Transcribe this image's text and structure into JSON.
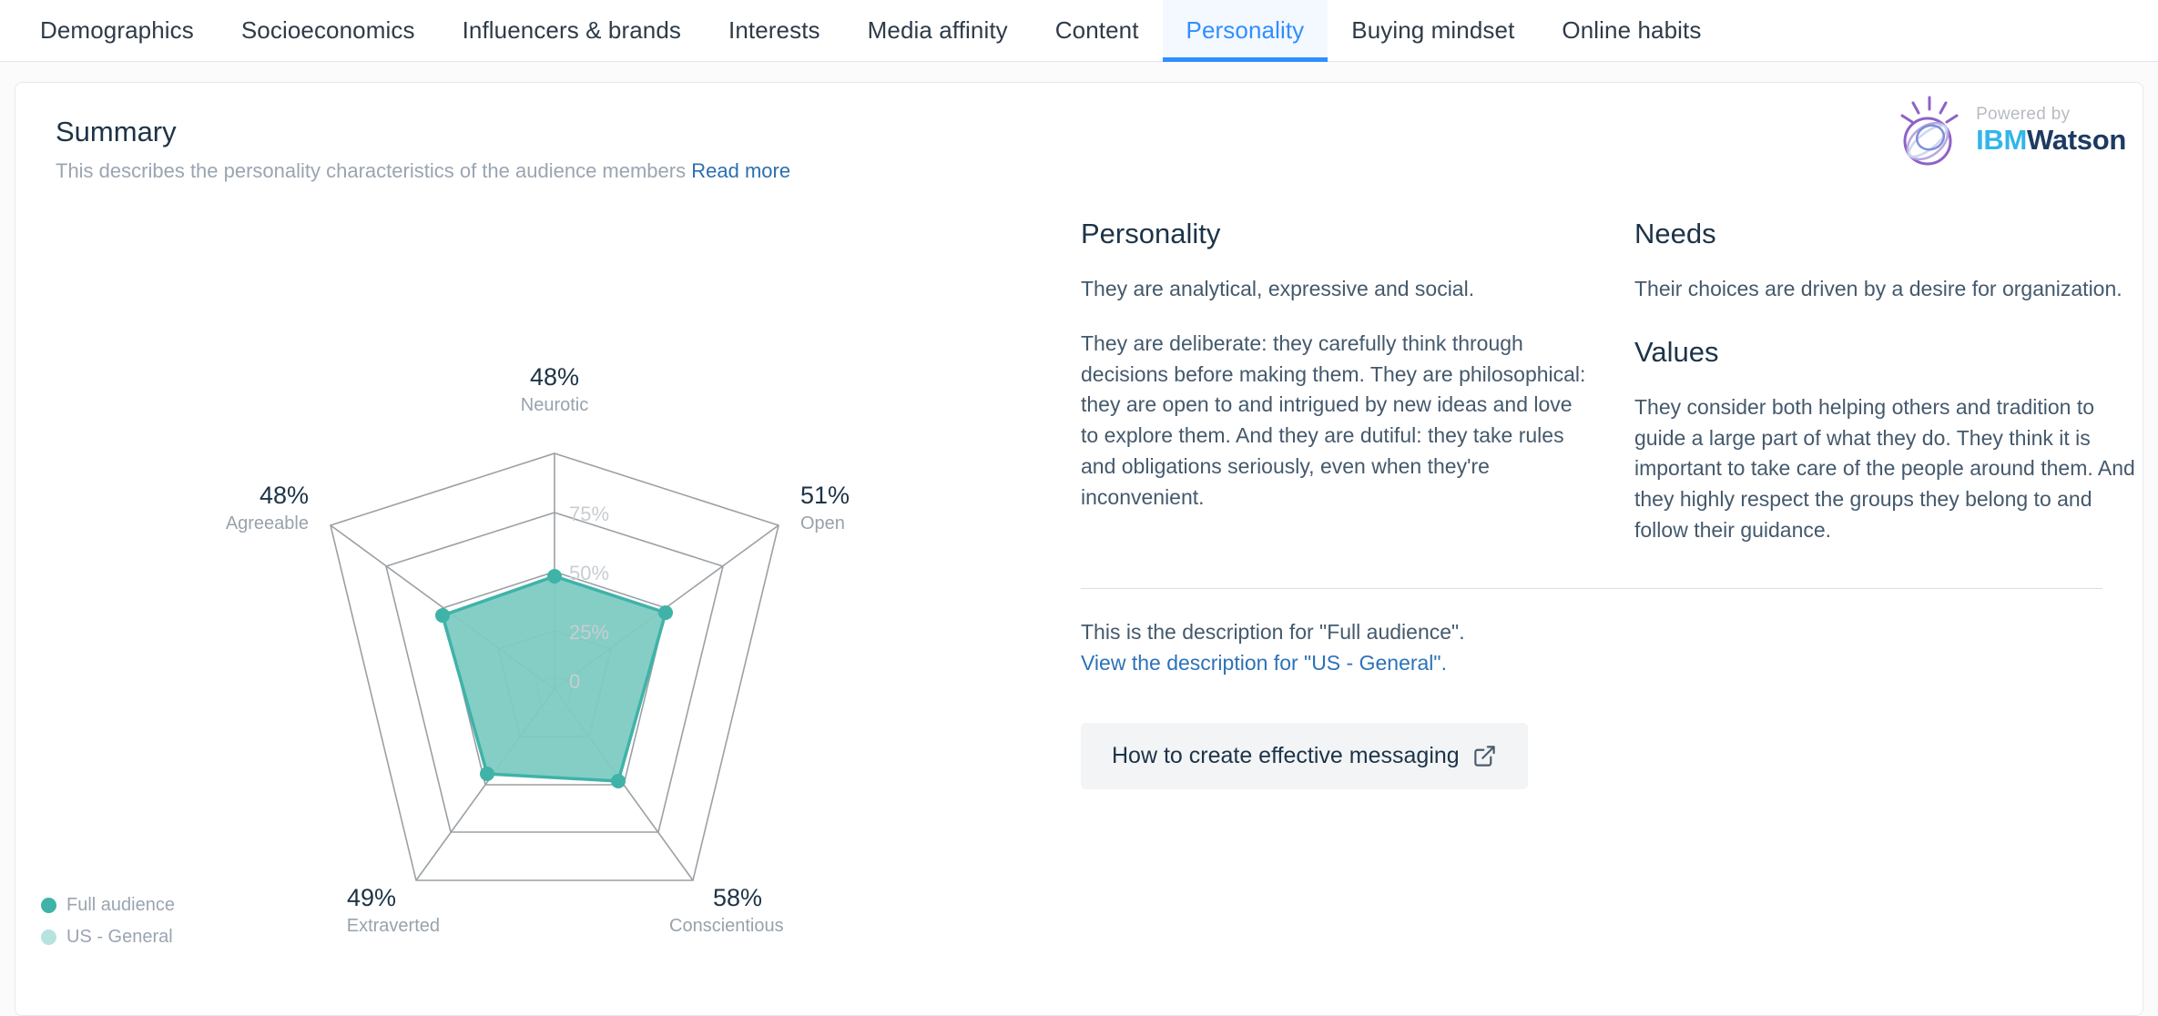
{
  "nav": {
    "tabs": [
      {
        "label": "Demographics",
        "active": false
      },
      {
        "label": "Socioeconomics",
        "active": false
      },
      {
        "label": "Influencers & brands",
        "active": false
      },
      {
        "label": "Interests",
        "active": false
      },
      {
        "label": "Media affinity",
        "active": false
      },
      {
        "label": "Content",
        "active": false
      },
      {
        "label": "Personality",
        "active": true
      },
      {
        "label": "Buying mindset",
        "active": false
      },
      {
        "label": "Online habits",
        "active": false
      }
    ]
  },
  "card": {
    "title": "Summary",
    "subtitle": "This describes the personality characteristics of the audience members",
    "read_more": "Read more"
  },
  "watson": {
    "powered_by": "Powered by",
    "ibm": "IBM",
    "watson": "Watson"
  },
  "legend": [
    {
      "label": "Full audience",
      "color": "#3fb3a8"
    },
    {
      "label": "US - General",
      "color": "#b6e3dd"
    }
  ],
  "sections": {
    "personality": {
      "heading": "Personality",
      "p1": "They are analytical, expressive and social.",
      "p2": "They are deliberate: they carefully think through decisions before making them. They are philosophical: they are open to and intrigued by new ideas and love to explore them. And they are dutiful: they take rules and obligations seriously, even when they're inconvenient."
    },
    "needs": {
      "heading": "Needs",
      "p1": "Their choices are driven by a desire for organization."
    },
    "values": {
      "heading": "Values",
      "p1": "They consider both helping others and tradition to guide a large part of what they do. They think it is important to take care of the people around them. And they highly respect the groups they belong to and follow their guidance."
    }
  },
  "description": {
    "line1": "This is the description for \"Full audience\".",
    "line2": "View the description for \"US - General\"."
  },
  "cta": {
    "label": "How to create effective messaging",
    "icon": "external-link-icon"
  },
  "chart_data": {
    "type": "radar",
    "title": "",
    "categories": [
      "Neurotic",
      "Open",
      "Conscientious",
      "Extraverted",
      "Agreeable"
    ],
    "series": [
      {
        "name": "Full audience",
        "values": [
          48,
          51,
          58,
          49,
          48
        ],
        "color": "#3fb3a8",
        "fill": "#7dcbc3"
      },
      {
        "name": "US - General",
        "values": [],
        "color": "#b6e3dd",
        "fill": "#b6e3dd"
      }
    ],
    "value_labels": [
      "48%",
      "51%",
      "58%",
      "49%",
      "48%"
    ],
    "radial_ticks": [
      "0",
      "25%",
      "50%",
      "75%"
    ],
    "radial_tick_values": [
      0,
      25,
      50,
      75
    ],
    "rlim": [
      0,
      100
    ],
    "grid": true,
    "legend_position": "bottom-left"
  }
}
